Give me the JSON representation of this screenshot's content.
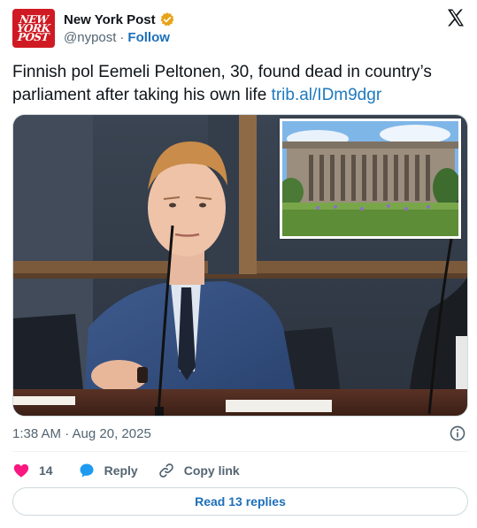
{
  "author": {
    "display_name": "New York Post",
    "handle": "@nypost",
    "separator": "·",
    "follow_label": "Follow",
    "avatar_lines": [
      "NEW",
      "YORK",
      "POST"
    ]
  },
  "tweet": {
    "text": "Finnish pol Eemeli Peltonen, 30, found dead in country’s parliament after taking his own life",
    "link_text": "trib.al/IDm9dgr"
  },
  "meta": {
    "timestamp": "1:38 AM · Aug 20, 2025"
  },
  "actions": {
    "like_count": "14",
    "reply_label": "Reply",
    "copy_link_label": "Copy link",
    "read_replies_label": "Read 13 replies"
  },
  "colors": {
    "brand_red": "#cf1a23",
    "link_blue": "#1d7abf",
    "heart_pink": "#f91880",
    "reply_blue": "#1d9bf0",
    "secondary_text": "#536471"
  }
}
